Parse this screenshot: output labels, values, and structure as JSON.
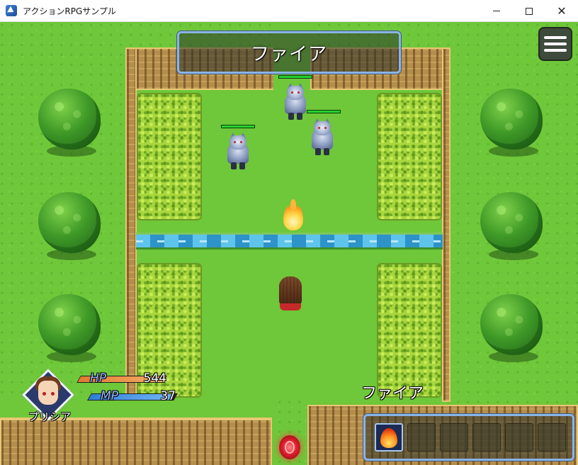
{
  "window": {
    "title": "アクションRPGサンプル",
    "minimize_label": "",
    "maximize_label": "",
    "close_label": "✕"
  },
  "hud": {
    "skill_banner": "ファイア",
    "equipped_skill": "ファイア",
    "character": {
      "name": "プリシア",
      "hp_label": "HP",
      "hp_value": "544",
      "hp_fraction": 1.0,
      "mp_label": "MP",
      "mp_value": "37",
      "mp_fraction": 0.95
    },
    "hotbar": {
      "slots": [
        "fire-skill",
        "",
        "",
        "",
        "",
        ""
      ]
    },
    "menu_icon": "hamburger-menu-icon"
  },
  "enemies": [
    {
      "name": "wolf",
      "hp_fraction": 1.0
    },
    {
      "name": "wolf",
      "hp_fraction": 1.0
    },
    {
      "name": "wolf",
      "hp_fraction": 1.0
    }
  ],
  "colors": {
    "grass": "#6fc73a",
    "hp_fill": "#e07a32",
    "mp_fill": "#2e7fd6",
    "enemy_hp": "#27d030",
    "panel_border": "#8ab4e6"
  }
}
